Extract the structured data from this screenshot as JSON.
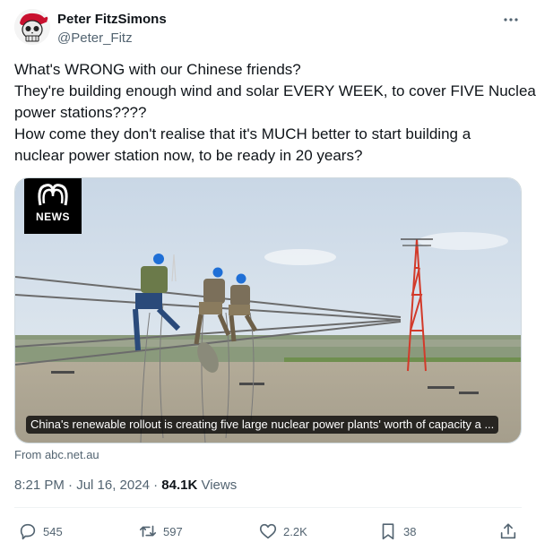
{
  "author": {
    "display_name": "Peter FitzSimons",
    "handle": "@Peter_Fitz",
    "avatar_icon": "pirate-skull-avatar"
  },
  "tweet_text": [
    "What's WRONG with our Chinese friends?",
    "They're building enough wind and solar EVERY WEEK, to cover FIVE Nuclear",
    "power stations????",
    "How come they don't realise that it's MUCH better to start building a",
    "nuclear power station now, to be ready in 20 years?"
  ],
  "link_card": {
    "logo_text": "NEWS",
    "caption": "China's renewable rollout is creating five large nuclear power plants' worth of capacity a ...",
    "source": "From abc.net.au"
  },
  "meta": {
    "timestamp": "8:21 PM · Jul 16, 2024",
    "separator": " · ",
    "views_count": "84.1K",
    "views_label": "Views"
  },
  "actions": {
    "replies": "545",
    "reposts": "597",
    "likes": "2.2K",
    "bookmarks": "38"
  },
  "colors": {
    "text": "#0f1419",
    "secondary": "#536471",
    "border": "#cfd9de"
  }
}
